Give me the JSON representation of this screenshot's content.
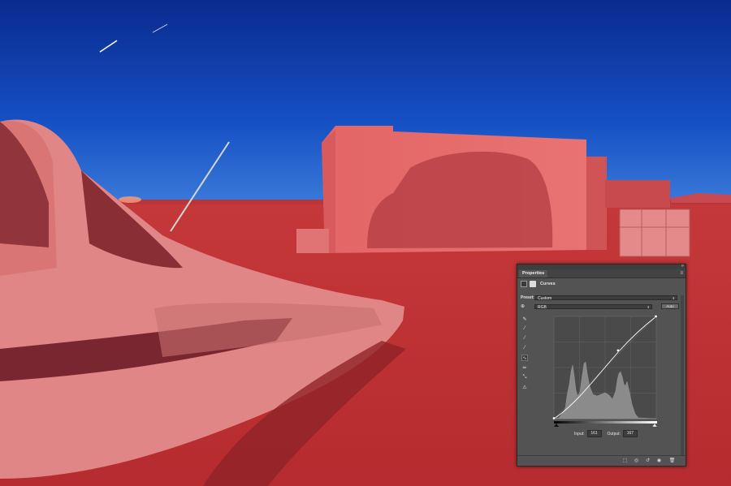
{
  "panel": {
    "title": "Properties",
    "adjustment": "Curves",
    "preset_label": "Preset:",
    "preset_value": "Custom",
    "channel_value": "RGB",
    "auto_label": "Auto",
    "input_label": "Input:",
    "input_value": "161",
    "output_label": "Output:",
    "output_value": "167"
  },
  "colors": {
    "sky": "#0a2a8e",
    "red_overlay": "#c8353a",
    "panel_bg": "#535353"
  },
  "icons": [
    "eyedropper-icon",
    "black-point-icon",
    "gray-point-icon",
    "white-point-icon",
    "curve-tool-icon",
    "pencil-icon",
    "smooth-icon",
    "warning-icon"
  ]
}
